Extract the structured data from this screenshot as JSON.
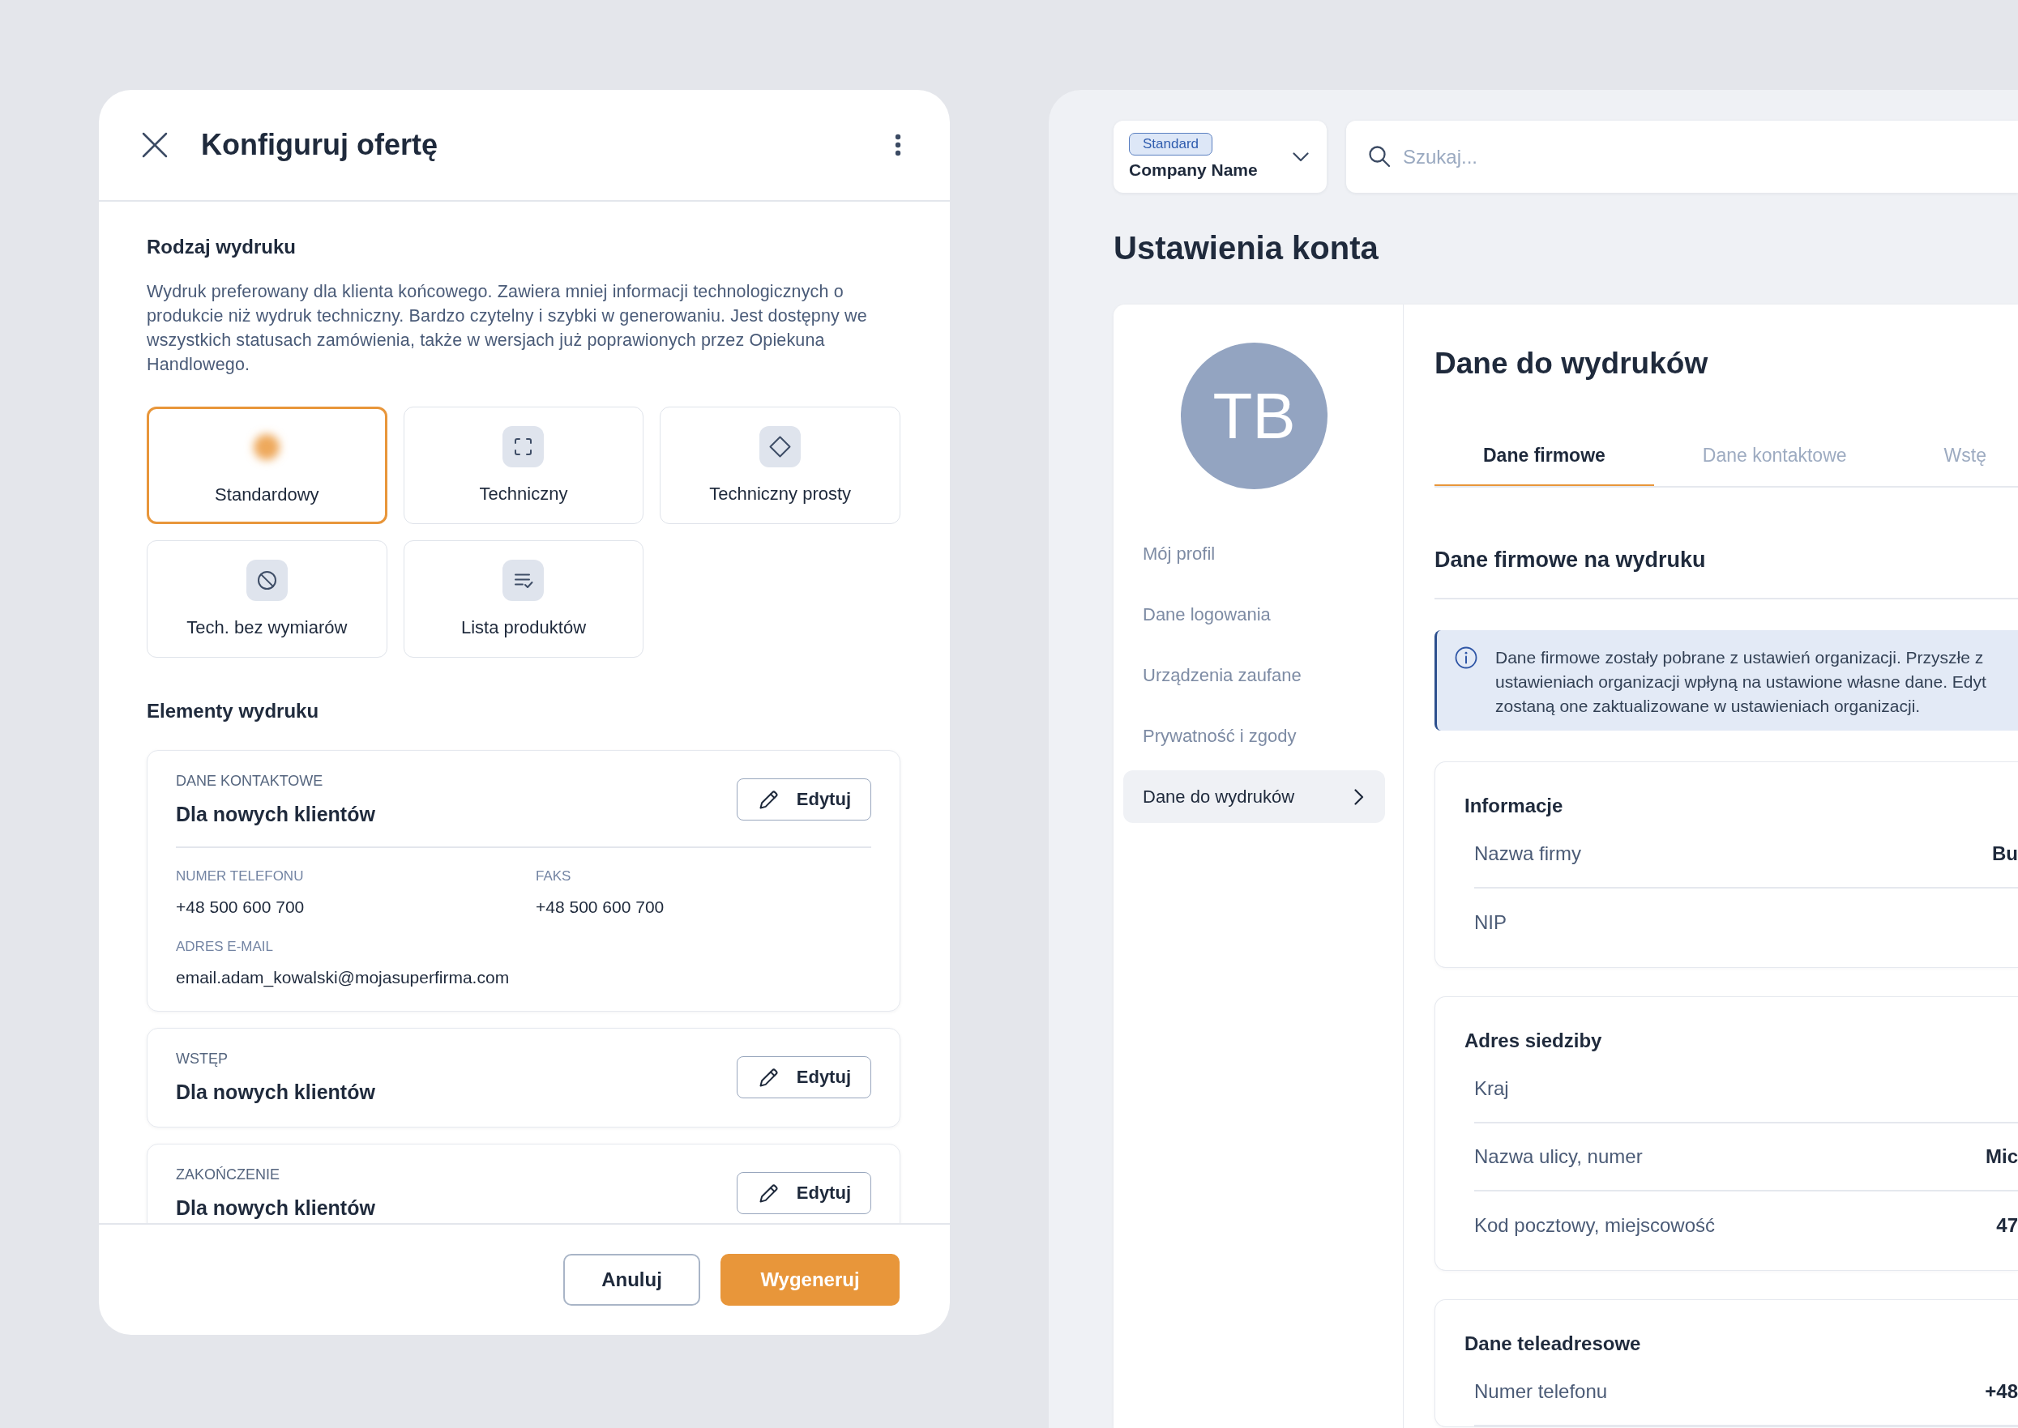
{
  "offer_dialog": {
    "title": "Konfiguruj ofertę",
    "print_type": {
      "heading": "Rodzaj wydruku",
      "description": "Wydruk preferowany dla klienta końcowego. Zawiera mniej informacji technologicznych o produkcie niż wydruk techniczny. Bardzo czytelny i szybki w generowaniu. Jest dostępny we wszystkich statusach zamówienia, także w wersjach już poprawionych przez Opiekuna Handlowego.",
      "options": [
        {
          "label": "Standardowy",
          "kind": "standard",
          "selected": true
        },
        {
          "label": "Techniczny",
          "kind": "technical",
          "selected": false
        },
        {
          "label": "Techniczny prosty",
          "kind": "simple",
          "selected": false
        },
        {
          "label": "Tech. bez wymiarów",
          "kind": "no-dimensions",
          "selected": false
        },
        {
          "label": "Lista produktów",
          "kind": "product-list",
          "selected": false
        }
      ]
    },
    "print_elements": {
      "heading": "Elementy wydruku",
      "sections": [
        {
          "label": "DANE KONTAKTOWE",
          "title": "Dla nowych klientów",
          "edit_button": "Edytuj",
          "fields": [
            {
              "label": "NUMER TELEFONU",
              "value": "+48 500 600 700"
            },
            {
              "label": "FAKS",
              "value": "+48 500 600 700"
            },
            {
              "label": "ADRES E-MAIL",
              "value": "email.adam_kowalski@mojasuperfirma.com"
            }
          ]
        },
        {
          "label": "WSTĘP",
          "title": "Dla nowych klientów",
          "edit_button": "Edytuj"
        },
        {
          "label": "ZAKOŃCZENIE",
          "title": "Dla nowych klientów",
          "edit_button": "Edytuj"
        }
      ]
    },
    "buttons": [
      {
        "label": "Anuluj",
        "kind": "secondary"
      },
      {
        "label": "Wygeneruj",
        "kind": "primary"
      }
    ]
  },
  "account_settings": {
    "company_selector": {
      "badge": "Standard",
      "name": "Company Name"
    },
    "search": {
      "placeholder": "Szukaj..."
    },
    "title": "Ustawienia konta",
    "profile": {
      "initials": "TB"
    },
    "nav_items": [
      {
        "label": "Mój profil",
        "selected": false
      },
      {
        "label": "Dane logowania",
        "selected": false
      },
      {
        "label": "Urządzenia zaufane",
        "selected": false
      },
      {
        "label": "Prywatność i zgody",
        "selected": false
      },
      {
        "label": "Dane do wydruków",
        "selected": true
      }
    ],
    "section_title": "Dane do wydruków",
    "tabs": [
      {
        "label": "Dane firmowe",
        "selected": true
      },
      {
        "label": "Dane kontaktowe",
        "selected": false
      },
      {
        "label": "Wstę",
        "selected": false
      }
    ],
    "subsection_title": "Dane firmowe na wydruku",
    "info": {
      "lines": [
        "Dane firmowe zostały pobrane z ustawień organizacji. Przyszłe z",
        "ustawieniach organizacji wpłyną na ustawione własne dane. Edyt",
        "zostaną one zaktualizowane w ustawieniach organizacji."
      ]
    },
    "groups": [
      {
        "title": "Informacje",
        "rows": [
          {
            "label": "Nazwa firmy",
            "value": "Bu"
          },
          {
            "label": "NIP"
          }
        ]
      },
      {
        "title": "Adres siedziby",
        "rows": [
          {
            "label": "Kraj"
          },
          {
            "label": "Nazwa ulicy, numer",
            "value": "Mic"
          },
          {
            "label": "Kod pocztowy, miejscowość",
            "value": "47"
          }
        ]
      },
      {
        "title": "Dane teleadresowe",
        "rows": [
          {
            "label": "Numer telefonu",
            "value": "+48"
          }
        ]
      }
    ]
  }
}
